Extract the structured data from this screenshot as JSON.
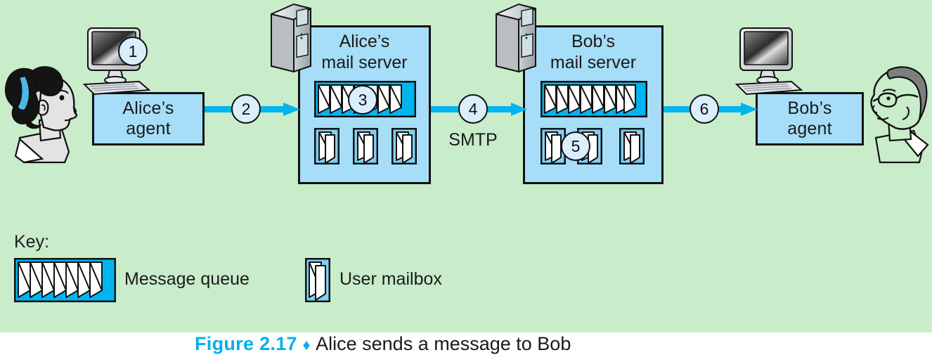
{
  "figure": {
    "number_label": "Figure 2.17",
    "diamond": "♦",
    "caption_text": "Alice sends a message to Bob"
  },
  "colors": {
    "background_green": "#c9eccb",
    "box_blue": "#a6ddf8",
    "arrow_cyan": "#00b5ef",
    "circle_fill": "#dbeefc",
    "queue_cyan": "#00b5ef",
    "mailbox_blue": "#7fd0f4",
    "outline": "#111111",
    "caption_accent": "#00b0f0"
  },
  "nodes": {
    "alice_agent": {
      "label": "Alice’s\nagent",
      "line1": "Alice’s",
      "line2": "agent"
    },
    "alice_server": {
      "line1": "Alice’s",
      "line2": "mail server"
    },
    "bob_server": {
      "line1": "Bob’s",
      "line2": "mail server"
    },
    "bob_agent": {
      "line1": "Bob’s",
      "line2": "agent"
    }
  },
  "steps": [
    {
      "id": "1",
      "label": "1",
      "desc": "alice-composes-at-user-agent"
    },
    {
      "id": "2",
      "label": "2",
      "desc": "agent-to-alice-mail-server"
    },
    {
      "id": "3",
      "label": "3",
      "desc": "message-placed-in-alice-queue"
    },
    {
      "id": "4",
      "label": "4",
      "desc": "smtp-transfer-between-servers"
    },
    {
      "id": "5",
      "label": "5",
      "desc": "message-placed-in-bob-mailbox"
    },
    {
      "id": "6",
      "label": "6",
      "desc": "bob-agent-retrieves-message"
    }
  ],
  "protocols": [
    {
      "label": "SMTP"
    }
  ],
  "key": {
    "title": "Key:",
    "items": [
      {
        "icon": "message-queue-icon",
        "label": "Message queue"
      },
      {
        "icon": "user-mailbox-icon",
        "label": "User mailbox"
      }
    ]
  },
  "actors": [
    {
      "name": "alice-avatar",
      "desc": "woman facing right with dark hair and blue headband"
    },
    {
      "name": "bob-avatar",
      "desc": "man facing left with gray hair and glasses"
    }
  ],
  "devices": [
    {
      "name": "alice-computer-icon",
      "desc": "desktop monitor and keyboard"
    },
    {
      "name": "alice-server-tower-icon",
      "desc": "server tower"
    },
    {
      "name": "bob-server-tower-icon",
      "desc": "server tower"
    },
    {
      "name": "bob-computer-icon",
      "desc": "desktop monitor and keyboard"
    }
  ]
}
